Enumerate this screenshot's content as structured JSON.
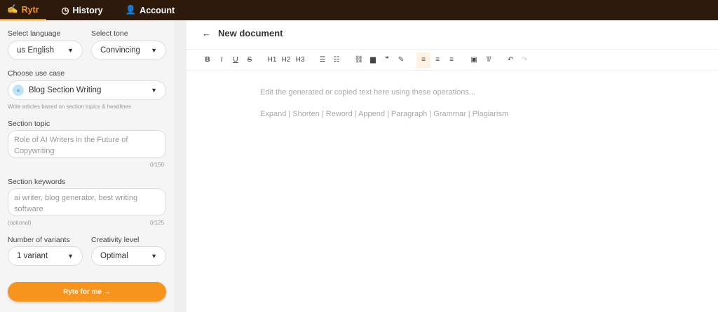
{
  "nav": {
    "rytr": "Rytr",
    "history": "History",
    "account": "Account"
  },
  "sidebar": {
    "language_label": "Select language",
    "language_value": "us English",
    "tone_label": "Select tone",
    "tone_value": "Convincing",
    "usecase_label": "Choose use case",
    "usecase_value": "Blog Section Writing",
    "usecase_hint": "Write articles based on section topics & headlines",
    "topic_label": "Section topic",
    "topic_placeholder": "Role of AI Writers in the Future of Copywriting",
    "topic_count": "0/150",
    "keywords_label": "Section keywords",
    "keywords_placeholder": "ai writer, blog generator, best writing software",
    "keywords_optional": "(optional)",
    "keywords_count": "0/125",
    "variants_label": "Number of variants",
    "variants_value": "1 variant",
    "creativity_label": "Creativity level",
    "creativity_value": "Optimal",
    "submit": "Ryte for me →"
  },
  "editor": {
    "title": "New document",
    "toolbar": [
      "B",
      "I",
      "U",
      "S",
      "H1",
      "H2",
      "H3",
      "☰",
      "☷",
      "⛓",
      "▆",
      "❞",
      "✎",
      "≡",
      "≡",
      "≡",
      "▣",
      "T̸",
      "↶",
      "↷"
    ],
    "placeholder1": "Edit the generated or copied text here using these operations...",
    "placeholder2": "Expand | Shorten | Reword | Append | Paragraph | Grammar | Plagiarism"
  },
  "colors": {
    "accent": "#f7941d",
    "header": "#2d1a0b"
  }
}
